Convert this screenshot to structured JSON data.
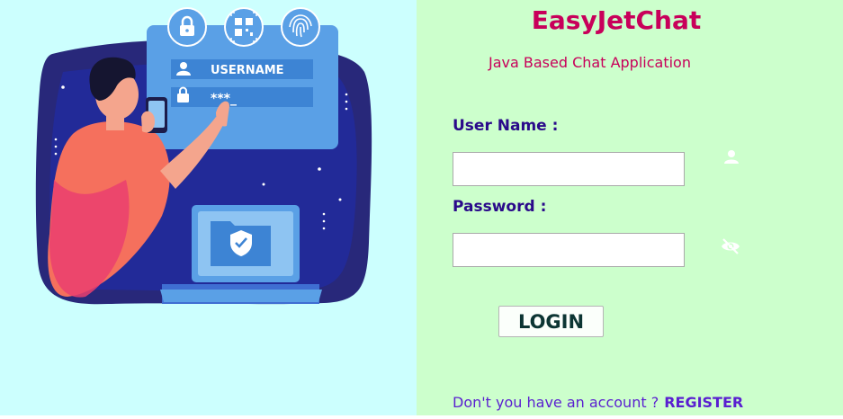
{
  "app": {
    "title": "EasyJetChat",
    "subtitle": "Java Based Chat Application"
  },
  "illustration": {
    "username_text": "USERNAME",
    "password_text": "***_",
    "icons": [
      "lock-icon",
      "qr-code-icon",
      "fingerprint-icon",
      "user-icon",
      "lock-icon",
      "shield-check-icon"
    ]
  },
  "form": {
    "username_label": "User Name :",
    "username_value": "",
    "password_label": "Password :",
    "password_value": "",
    "username_icon": "user-icon",
    "password_icon": "eye-slash-icon",
    "login_label": "LOGIN"
  },
  "footer": {
    "prompt": "Don't you have an account ?",
    "register_label": "REGISTER"
  },
  "colors": {
    "left_bg": "#ccfffe",
    "right_bg": "#ccffcc",
    "title": "#c8005a",
    "label": "#2a0a8a",
    "link": "#5a1fd0"
  }
}
